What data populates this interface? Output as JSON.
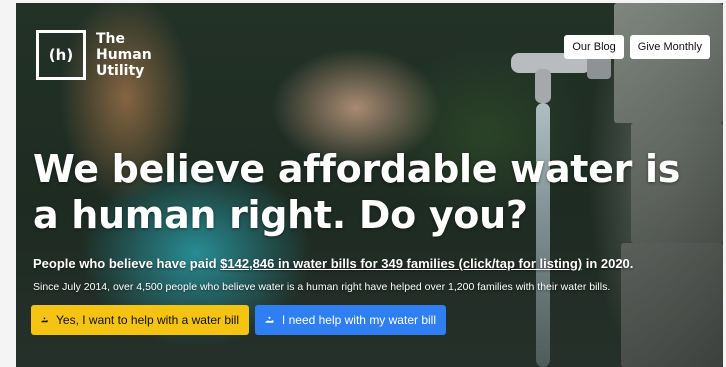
{
  "brand": {
    "logo_mark": "(h)",
    "name": "The Human Utility"
  },
  "nav": {
    "blog_label": "Our Blog",
    "give_label": "Give Monthly"
  },
  "hero": {
    "headline": "We believe affordable water is a human right. Do you?",
    "stat_prefix": "People who believe have paid ",
    "stat_link": "$142,846 in water bills for 349 families (click/tap for listing)",
    "stat_suffix": " in 2020.",
    "stat_secondary": "Since July 2014, over 4,500 people who believe water is a human right have helped over 1,200 families with their water bills."
  },
  "cta": {
    "help_label": "Yes, I want to help with a water bill",
    "need_label": "I need help with my water bill",
    "help_icon": "hand-heart-icon",
    "need_icon": "hand-heart-icon"
  },
  "colors": {
    "help_button": "#f5c312",
    "need_button": "#2f7ff2"
  }
}
